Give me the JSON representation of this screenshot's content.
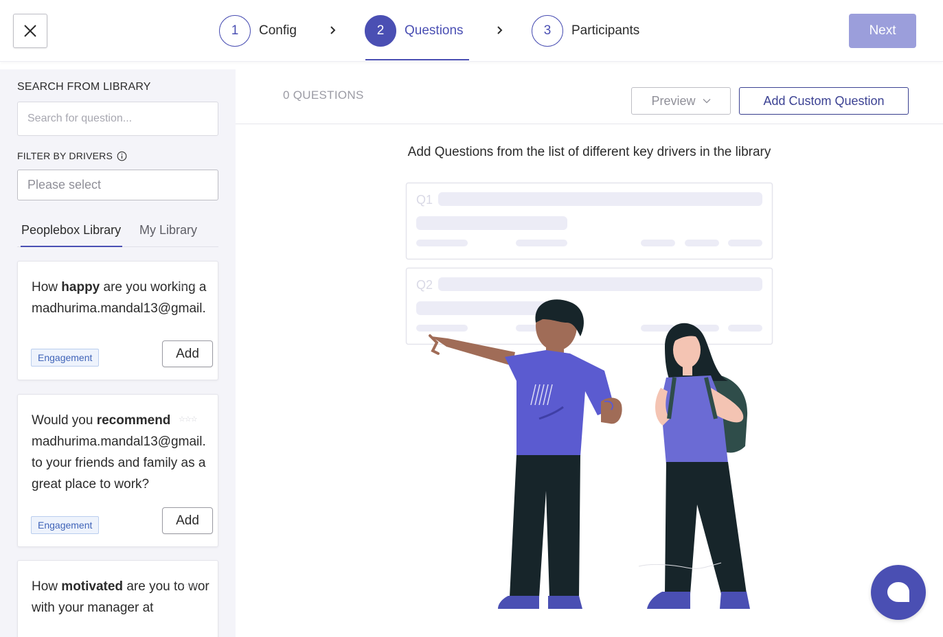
{
  "header": {
    "close_icon": "close-icon",
    "steps": [
      {
        "number": "1",
        "label": "Config",
        "active": false
      },
      {
        "number": "2",
        "label": "Questions",
        "active": true
      },
      {
        "number": "3",
        "label": "Participants",
        "active": false
      }
    ],
    "next_label": "Next"
  },
  "sidebar": {
    "search_title": "SEARCH FROM LIBRARY",
    "search_placeholder": "Search for question...",
    "filter_title": "FILTER BY DRIVERS",
    "filter_placeholder": "Please select",
    "tabs": [
      "Peoplebox Library",
      "My Library"
    ],
    "active_tab": "Peoplebox Library",
    "questions": [
      {
        "before": "How ",
        "bold": "happy",
        "after": " are you working a",
        "line2": "madhurima.mandal13@gmail.",
        "line3": "",
        "line4": "",
        "tag": "Engagement",
        "add_label": "Add"
      },
      {
        "before": "Would you ",
        "bold": "recommend",
        "after": "",
        "line2": "madhurima.mandal13@gmail.",
        "line3": "to your friends and family as a",
        "line4": "great place to work?",
        "tag": "Engagement",
        "add_label": "Add"
      },
      {
        "before": "How ",
        "bold": "motivated",
        "after": " are you to wor",
        "line2": "with your manager at",
        "line3": "",
        "line4": ""
      }
    ]
  },
  "main": {
    "question_count": "0 QUESTIONS",
    "preview_label": "Preview",
    "add_custom_label": "Add Custom Question",
    "empty_message": "Add Questions from the list of different key drivers in the library",
    "placeholder_labels": [
      "Q1",
      "Q2"
    ]
  },
  "colors": {
    "accent": "#4a4fb3",
    "next_disabled": "#9b9edb",
    "shirt": "#5b5bd0",
    "pants": "#17252a",
    "tag_text": "#3f63b8"
  }
}
